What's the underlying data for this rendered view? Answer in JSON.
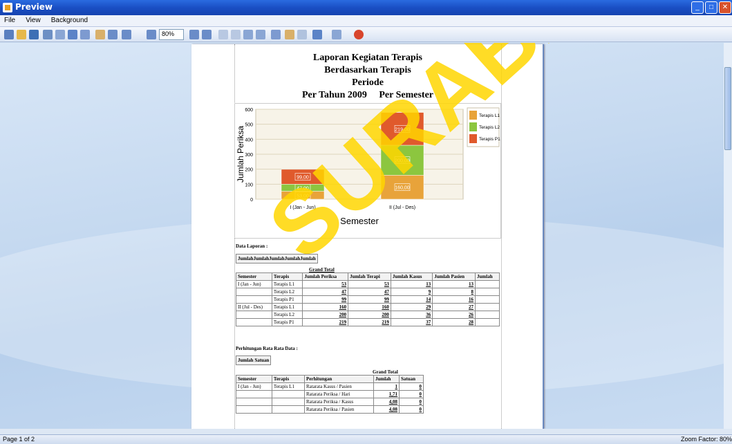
{
  "window": {
    "title": "Preview"
  },
  "menu": [
    "File",
    "View",
    "Background"
  ],
  "toolbar": {
    "zoom_value": "80%"
  },
  "report": {
    "title_lines": [
      "Laporan Kegiatan Terapis",
      "Berdasarkan Terapis",
      "Periode"
    ],
    "period_year": "Per Tahun 2009",
    "period_semester": "Per Semester"
  },
  "chart_data": {
    "type": "bar",
    "stacked": true,
    "categories": [
      "I (Jan - Jun)",
      "II (Jul - Des)"
    ],
    "series": [
      {
        "name": "Terapis L1",
        "values": [
          53,
          160
        ],
        "labels": [
          "53,00",
          "160,00"
        ],
        "color": "#e8a33a"
      },
      {
        "name": "Terapis L2",
        "values": [
          47,
          200
        ],
        "labels": [
          "47,00",
          "200,00"
        ],
        "color": "#8cc63f"
      },
      {
        "name": "Terapis P1",
        "values": [
          99,
          219
        ],
        "labels": [
          "99,00",
          "219,00"
        ],
        "color": "#e05a2c"
      }
    ],
    "xlabel": "Semester",
    "ylabel": "Jumlah Periksa",
    "ylim": [
      0,
      600
    ],
    "yticks": [
      "0",
      "100",
      "200",
      "300",
      "400",
      "500",
      "600"
    ],
    "grid": true,
    "legend": "top-right"
  },
  "data_section": {
    "label": "Data Laporan :",
    "header_fields": [
      "Jumlah",
      "Jumlah",
      "Jumlah",
      "Jumlah",
      "Jumlah"
    ],
    "grand_total": "Grand Total",
    "columns": [
      "Semester",
      "Terapis",
      "Jumlah Periksa",
      "Jumlah Terapi",
      "Jumlah Kasus",
      "Jumlah Pasien",
      "Jumlah"
    ],
    "rows": [
      [
        "I (Jan - Jun)",
        "Terapis L1",
        "53",
        "53",
        "13",
        "13",
        ""
      ],
      [
        "",
        "Terapis L2",
        "47",
        "47",
        "9",
        "8",
        ""
      ],
      [
        "",
        "Terapis P1",
        "99",
        "99",
        "14",
        "16",
        ""
      ],
      [
        "II (Jul - Des)",
        "Terapis L1",
        "160",
        "160",
        "29",
        "27",
        ""
      ],
      [
        "",
        "Terapis L2",
        "200",
        "200",
        "36",
        "26",
        ""
      ],
      [
        "",
        "Terapis P1",
        "219",
        "219",
        "37",
        "28",
        ""
      ]
    ]
  },
  "avg_section": {
    "label": "Perhitungan Rata Rata Data :",
    "header_fields": [
      "Jumlah",
      "Satuan"
    ],
    "grand_total": "Grand Total",
    "columns": [
      "Semester",
      "Terapis",
      "Perhitungan",
      "Jumlah",
      "Satuan"
    ],
    "rows": [
      [
        "I (Jan - Jun)",
        "Terapis L1",
        "Ratarata Kasus / Pasien",
        "1",
        "0"
      ],
      [
        "",
        "",
        "Ratarata Periksa / Hari",
        "1,71",
        "0"
      ],
      [
        "",
        "",
        "Ratarata Periksa / Kasus",
        "4,08",
        "0"
      ],
      [
        "",
        "",
        "Ratarata Periksa / Pasien",
        "4,08",
        "0"
      ]
    ]
  },
  "status": {
    "page": "Page 1 of 2",
    "zoom": "Zoom Factor: 80%"
  },
  "watermark": "SURABAYA"
}
